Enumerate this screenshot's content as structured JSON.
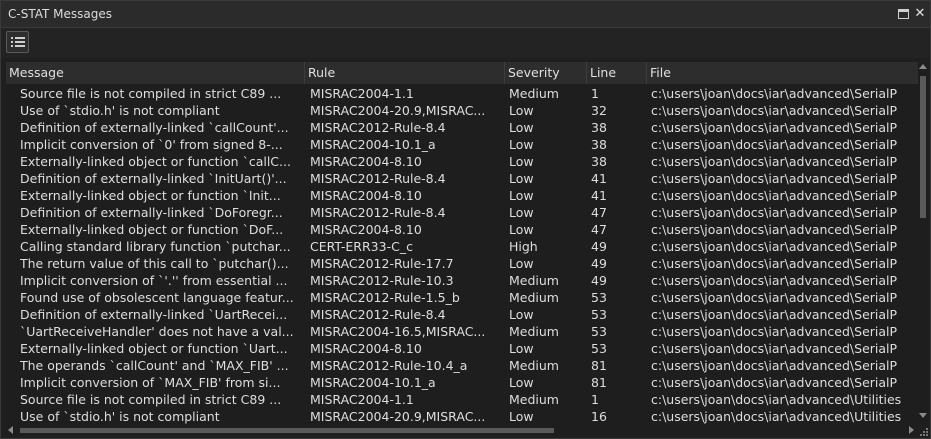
{
  "window": {
    "title": "C-STAT Messages"
  },
  "toolbar": {
    "list_icon": "list-icon"
  },
  "columns": {
    "message": "Message",
    "rule": "Rule",
    "severity": "Severity",
    "line": "Line",
    "file": "File"
  },
  "rows": [
    {
      "message": "Source file is not compiled in strict C89 ...",
      "rule": "MISRAC2004-1.1",
      "severity": "Medium",
      "line": "1",
      "file": "c:\\users\\joan\\docs\\iar\\advanced\\SerialP"
    },
    {
      "message": "Use of `stdio.h' is not compliant",
      "rule": "MISRAC2004-20.9,MISRAC...",
      "severity": "Low",
      "line": "32",
      "file": "c:\\users\\joan\\docs\\iar\\advanced\\SerialP"
    },
    {
      "message": "Definition of externally-linked `callCount'...",
      "rule": "MISRAC2012-Rule-8.4",
      "severity": "Low",
      "line": "38",
      "file": "c:\\users\\joan\\docs\\iar\\advanced\\SerialP"
    },
    {
      "message": "Implicit conversion of `0' from signed 8-...",
      "rule": "MISRAC2004-10.1_a",
      "severity": "Low",
      "line": "38",
      "file": "c:\\users\\joan\\docs\\iar\\advanced\\SerialP"
    },
    {
      "message": "Externally-linked object or function `callC...",
      "rule": "MISRAC2004-8.10",
      "severity": "Low",
      "line": "38",
      "file": "c:\\users\\joan\\docs\\iar\\advanced\\SerialP"
    },
    {
      "message": "Definition of externally-linked `InitUart()'...",
      "rule": "MISRAC2012-Rule-8.4",
      "severity": "Low",
      "line": "41",
      "file": "c:\\users\\joan\\docs\\iar\\advanced\\SerialP"
    },
    {
      "message": "Externally-linked object or function `Init...",
      "rule": "MISRAC2004-8.10",
      "severity": "Low",
      "line": "41",
      "file": "c:\\users\\joan\\docs\\iar\\advanced\\SerialP"
    },
    {
      "message": "Definition of externally-linked `DoForegr...",
      "rule": "MISRAC2012-Rule-8.4",
      "severity": "Low",
      "line": "47",
      "file": "c:\\users\\joan\\docs\\iar\\advanced\\SerialP"
    },
    {
      "message": "Externally-linked object or function `DoF...",
      "rule": "MISRAC2004-8.10",
      "severity": "Low",
      "line": "47",
      "file": "c:\\users\\joan\\docs\\iar\\advanced\\SerialP"
    },
    {
      "message": "Calling standard library function `putchar...",
      "rule": "CERT-ERR33-C_c",
      "severity": "High",
      "line": "49",
      "file": "c:\\users\\joan\\docs\\iar\\advanced\\SerialP"
    },
    {
      "message": "The return value of this call to `putchar()...",
      "rule": "MISRAC2012-Rule-17.7",
      "severity": "Low",
      "line": "49",
      "file": "c:\\users\\joan\\docs\\iar\\advanced\\SerialP"
    },
    {
      "message": "Implicit conversion of `'.'' from essential ...",
      "rule": "MISRAC2012-Rule-10.3",
      "severity": "Medium",
      "line": "49",
      "file": "c:\\users\\joan\\docs\\iar\\advanced\\SerialP"
    },
    {
      "message": "Found use of obsolescent language featur...",
      "rule": "MISRAC2012-Rule-1.5_b",
      "severity": "Medium",
      "line": "53",
      "file": "c:\\users\\joan\\docs\\iar\\advanced\\SerialP"
    },
    {
      "message": "Definition of externally-linked `UartRecei...",
      "rule": "MISRAC2012-Rule-8.4",
      "severity": "Low",
      "line": "53",
      "file": "c:\\users\\joan\\docs\\iar\\advanced\\SerialP"
    },
    {
      "message": "`UartReceiveHandler' does not have a val...",
      "rule": "MISRAC2004-16.5,MISRAC...",
      "severity": "Medium",
      "line": "53",
      "file": "c:\\users\\joan\\docs\\iar\\advanced\\SerialP"
    },
    {
      "message": "Externally-linked object or function `Uart...",
      "rule": "MISRAC2004-8.10",
      "severity": "Low",
      "line": "53",
      "file": "c:\\users\\joan\\docs\\iar\\advanced\\SerialP"
    },
    {
      "message": "The operands `callCount' and `MAX_FIB' ...",
      "rule": "MISRAC2012-Rule-10.4_a",
      "severity": "Medium",
      "line": "81",
      "file": "c:\\users\\joan\\docs\\iar\\advanced\\SerialP"
    },
    {
      "message": "Implicit conversion of `MAX_FIB' from si...",
      "rule": "MISRAC2004-10.1_a",
      "severity": "Low",
      "line": "81",
      "file": "c:\\users\\joan\\docs\\iar\\advanced\\SerialP"
    },
    {
      "message": "Source file is not compiled in strict C89 ...",
      "rule": "MISRAC2004-1.1",
      "severity": "Medium",
      "line": "1",
      "file": "c:\\users\\joan\\docs\\iar\\advanced\\Utilities"
    },
    {
      "message": "Use of `stdio.h' is not compliant",
      "rule": "MISRAC2004-20.9,MISRAC...",
      "severity": "Low",
      "line": "16",
      "file": "c:\\users\\joan\\docs\\iar\\advanced\\Utilities"
    }
  ]
}
